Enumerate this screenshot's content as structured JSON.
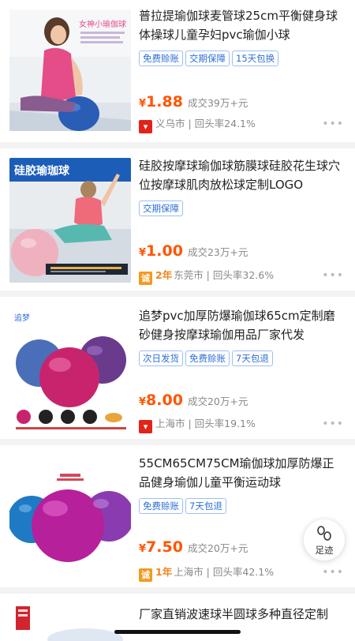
{
  "colors": {
    "price": "#ff5500",
    "tag_blue": "#2f6fd6",
    "badge_red": "#e2231a",
    "badge_orange": "#f39a1f"
  },
  "products": [
    {
      "title": "普拉提瑜伽球麦管球25cm平衡健身球体操球儿童孕妇pvc瑜伽小球",
      "tags": [
        "免费赊账",
        "交期保障",
        "15天包换"
      ],
      "currency": "¥",
      "price": "1.88",
      "sold": "成交39万+元",
      "location": "义乌市 | 回头率24.1%",
      "more": "•••",
      "image_text": "女神小瑜伽球"
    },
    {
      "title": "硅胶按摩球瑜伽球筋膜球硅胶花生球穴位按摩球肌肉放松球定制LOGO",
      "tags": [
        "交期保障"
      ],
      "currency": "¥",
      "price": "1.00",
      "sold": "成交23万+元",
      "years": "2年",
      "location": "东莞市 | 回头率32.6%",
      "more": "•••",
      "image_text": "硅胶瑜珈球"
    },
    {
      "title": "追梦pvc加厚防爆瑜伽球65cm定制磨砂健身按摩球瑜伽用品厂家代发",
      "tags": [
        "次日发货",
        "免费赊账",
        "7天包退"
      ],
      "currency": "¥",
      "price": "8.00",
      "sold": "成交20万+元",
      "location": "上海市 | 回头率19.1%",
      "more": "•••",
      "image_text": "追梦"
    },
    {
      "title": "55CM65CM75CM瑜伽球加厚防爆正品健身瑜伽儿童平衡运动球",
      "tags": [
        "免费赊账",
        "7天包退"
      ],
      "currency": "¥",
      "price": "7.50",
      "sold": "成交20万+元",
      "years": "1年",
      "location": "上海市 | 回头率42.1%",
      "more": "•••"
    },
    {
      "title": "厂家直销波速球半圆球多种直径定制"
    }
  ],
  "footprint": {
    "label": "足迹",
    "icon": "footprint-icon"
  }
}
